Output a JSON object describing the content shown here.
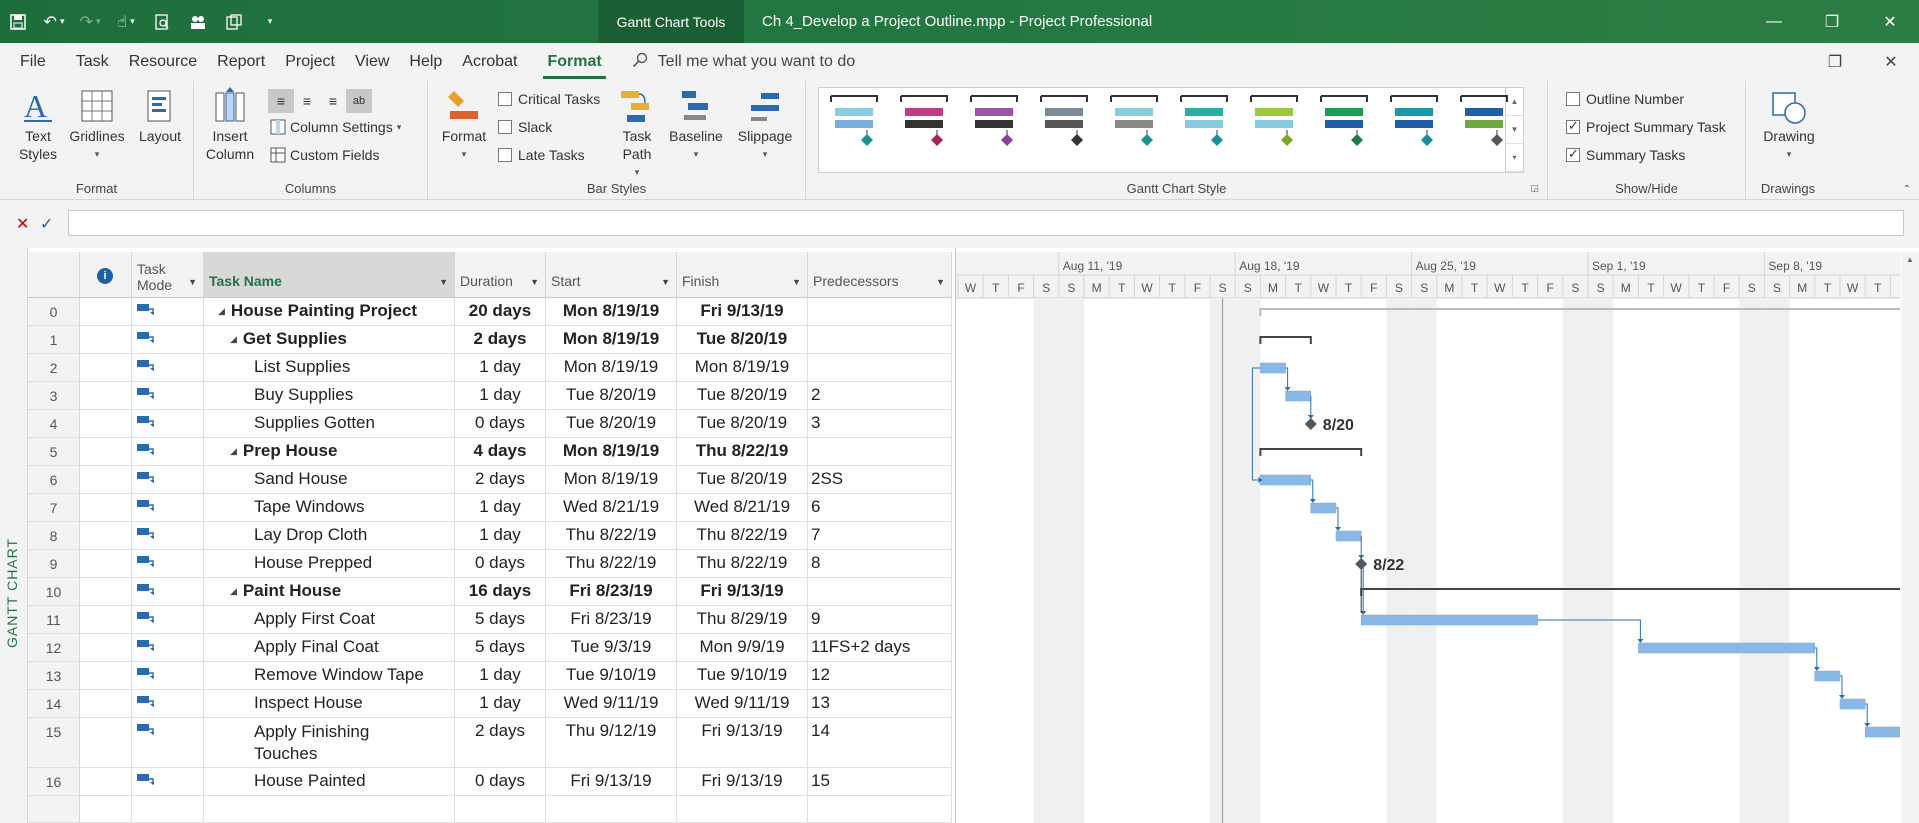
{
  "titlebar": {
    "tools_tab": "Gantt Chart Tools",
    "doc_title": "Ch 4_Develop a Project Outline.mpp  -  Project Professional"
  },
  "menu": {
    "tabs": [
      "File",
      "Task",
      "Resource",
      "Report",
      "Project",
      "View",
      "Help",
      "Acrobat",
      "Format"
    ],
    "active_tab": "Format",
    "tell_me": "Tell me what you want to do"
  },
  "ribbon": {
    "format_group": {
      "label": "Format",
      "text_styles": "Text\nStyles",
      "gridlines": "Gridlines",
      "layout": "Layout"
    },
    "columns_group": {
      "label": "Columns",
      "insert_column": "Insert\nColumn",
      "column_settings": "Column Settings",
      "custom_fields": "Custom Fields"
    },
    "bar_styles_group": {
      "label": "Bar Styles",
      "format": "Format",
      "critical_tasks": "Critical Tasks",
      "slack": "Slack",
      "late_tasks": "Late Tasks",
      "task_path": "Task\nPath",
      "baseline": "Baseline",
      "slippage": "Slippage"
    },
    "gantt_style_group": {
      "label": "Gantt Chart Style",
      "swatches": [
        {
          "top": "#89cce0",
          "bottom": "#7ab0e0",
          "marker": "#1e8f94"
        },
        {
          "top": "#c23c84",
          "bottom": "#333333",
          "marker": "#a0245e"
        },
        {
          "top": "#9b52a8",
          "bottom": "#333333",
          "marker": "#8c3e9b"
        },
        {
          "top": "#7a8a99",
          "bottom": "#555555",
          "marker": "#333333"
        },
        {
          "top": "#89cce0",
          "bottom": "#888888",
          "marker": "#1e8f94"
        },
        {
          "top": "#26b0a0",
          "bottom": "#89cce0",
          "marker": "#1e8f94"
        },
        {
          "top": "#9cc83c",
          "bottom": "#89cce0",
          "marker": "#7aa82a"
        },
        {
          "top": "#1aa050",
          "bottom": "#1f5fa8",
          "marker": "#1a8040"
        },
        {
          "top": "#1a9aa8",
          "bottom": "#1f5fa8",
          "marker": "#1a8a98"
        },
        {
          "top": "#1f5fa8",
          "bottom": "#6fa840",
          "marker": "#555555"
        }
      ]
    },
    "show_hide_group": {
      "label": "Show/Hide",
      "outline_number": {
        "label": "Outline Number",
        "checked": false
      },
      "project_summary_task": {
        "label": "Project Summary Task",
        "checked": true
      },
      "summary_tasks": {
        "label": "Summary Tasks",
        "checked": true
      }
    },
    "drawings_group": {
      "label": "Drawings",
      "drawing": "Drawing"
    }
  },
  "view_label": "GANTT CHART",
  "table": {
    "headers": {
      "mode": "Task\nMode",
      "name": "Task Name",
      "duration": "Duration",
      "start": "Start",
      "finish": "Finish",
      "predecessors": "Predecessors"
    },
    "rows": [
      {
        "id": "0",
        "name": "House Painting Project",
        "level": 0,
        "summary": true,
        "duration": "20 days",
        "start": "Mon 8/19/19",
        "finish": "Fri 9/13/19",
        "pred": ""
      },
      {
        "id": "1",
        "name": "Get Supplies",
        "level": 1,
        "summary": true,
        "duration": "2 days",
        "start": "Mon 8/19/19",
        "finish": "Tue 8/20/19",
        "pred": ""
      },
      {
        "id": "2",
        "name": "List Supplies",
        "level": 2,
        "summary": false,
        "duration": "1 day",
        "start": "Mon 8/19/19",
        "finish": "Mon 8/19/19",
        "pred": ""
      },
      {
        "id": "3",
        "name": "Buy Supplies",
        "level": 2,
        "summary": false,
        "duration": "1 day",
        "start": "Tue 8/20/19",
        "finish": "Tue 8/20/19",
        "pred": "2"
      },
      {
        "id": "4",
        "name": "Supplies Gotten",
        "level": 2,
        "summary": false,
        "duration": "0 days",
        "start": "Tue 8/20/19",
        "finish": "Tue 8/20/19",
        "pred": "3"
      },
      {
        "id": "5",
        "name": "Prep House",
        "level": 1,
        "summary": true,
        "duration": "4 days",
        "start": "Mon 8/19/19",
        "finish": "Thu 8/22/19",
        "pred": ""
      },
      {
        "id": "6",
        "name": "Sand House",
        "level": 2,
        "summary": false,
        "duration": "2 days",
        "start": "Mon 8/19/19",
        "finish": "Tue 8/20/19",
        "pred": "2SS"
      },
      {
        "id": "7",
        "name": "Tape Windows",
        "level": 2,
        "summary": false,
        "duration": "1 day",
        "start": "Wed 8/21/19",
        "finish": "Wed 8/21/19",
        "pred": "6"
      },
      {
        "id": "8",
        "name": "Lay Drop Cloth",
        "level": 2,
        "summary": false,
        "duration": "1 day",
        "start": "Thu 8/22/19",
        "finish": "Thu 8/22/19",
        "pred": "7"
      },
      {
        "id": "9",
        "name": "House Prepped",
        "level": 2,
        "summary": false,
        "duration": "0 days",
        "start": "Thu 8/22/19",
        "finish": "Thu 8/22/19",
        "pred": "8"
      },
      {
        "id": "10",
        "name": "Paint House",
        "level": 1,
        "summary": true,
        "duration": "16 days",
        "start": "Fri 8/23/19",
        "finish": "Fri 9/13/19",
        "pred": ""
      },
      {
        "id": "11",
        "name": "Apply First Coat",
        "level": 2,
        "summary": false,
        "duration": "5 days",
        "start": "Fri 8/23/19",
        "finish": "Thu 8/29/19",
        "pred": "9"
      },
      {
        "id": "12",
        "name": "Apply Final Coat",
        "level": 2,
        "summary": false,
        "duration": "5 days",
        "start": "Tue 9/3/19",
        "finish": "Mon 9/9/19",
        "pred": "11FS+2 days"
      },
      {
        "id": "13",
        "name": "Remove Window Tape",
        "level": 2,
        "summary": false,
        "duration": "1 day",
        "start": "Tue 9/10/19",
        "finish": "Tue 9/10/19",
        "pred": "12"
      },
      {
        "id": "14",
        "name": "Inspect House",
        "level": 2,
        "summary": false,
        "duration": "1 day",
        "start": "Wed 9/11/19",
        "finish": "Wed 9/11/19",
        "pred": "13"
      },
      {
        "id": "15",
        "name": "Apply Finishing Touches",
        "name_line1": "Apply Finishing",
        "name_line2": "Touches",
        "level": 2,
        "summary": false,
        "duration": "2 days",
        "start": "Thu 9/12/19",
        "finish": "Fri 9/13/19",
        "pred": "14"
      },
      {
        "id": "16",
        "name": "House Painted",
        "level": 2,
        "summary": false,
        "duration": "0 days",
        "start": "Fri 9/13/19",
        "finish": "Fri 9/13/19",
        "pred": "15"
      }
    ]
  },
  "gantt": {
    "weeks": [
      "Aug 11, '19",
      "Aug 18, '19",
      "Aug 25, '19",
      "Sep 1, '19",
      "Sep 8, '19"
    ],
    "day_letters": [
      "W",
      "T",
      "F",
      "S",
      "S",
      "M",
      "T",
      "W",
      "T",
      "F",
      "S",
      "S",
      "M",
      "T",
      "W",
      "T",
      "F",
      "S",
      "S",
      "M",
      "T",
      "W",
      "T",
      "F",
      "S",
      "S",
      "M",
      "T",
      "W",
      "T",
      "F",
      "S",
      "S",
      "M",
      "T",
      "W",
      "T",
      "F"
    ],
    "first_day_date": "2019-08-07",
    "today_date": "2019-08-17",
    "milestone_labels": [
      {
        "row": 4,
        "text": "8/20"
      },
      {
        "row": 9,
        "text": "8/22"
      }
    ],
    "bars": [
      {
        "row": 0,
        "start": "2019-08-19",
        "end": "2019-09-13",
        "type": "project"
      },
      {
        "row": 1,
        "start": "2019-08-19",
        "end": "2019-08-20",
        "type": "summary"
      },
      {
        "row": 2,
        "start": "2019-08-19",
        "end": "2019-08-19",
        "type": "task"
      },
      {
        "row": 3,
        "start": "2019-08-20",
        "end": "2019-08-20",
        "type": "task"
      },
      {
        "row": 4,
        "start": "2019-08-20",
        "end": "2019-08-20",
        "type": "milestone"
      },
      {
        "row": 5,
        "start": "2019-08-19",
        "end": "2019-08-22",
        "type": "summary"
      },
      {
        "row": 6,
        "start": "2019-08-19",
        "end": "2019-08-20",
        "type": "task"
      },
      {
        "row": 7,
        "start": "2019-08-21",
        "end": "2019-08-21",
        "type": "task"
      },
      {
        "row": 8,
        "start": "2019-08-22",
        "end": "2019-08-22",
        "type": "task"
      },
      {
        "row": 9,
        "start": "2019-08-22",
        "end": "2019-08-22",
        "type": "milestone"
      },
      {
        "row": 10,
        "start": "2019-08-23",
        "end": "2019-09-13",
        "type": "summary"
      },
      {
        "row": 11,
        "start": "2019-08-23",
        "end": "2019-08-29",
        "type": "task"
      },
      {
        "row": 12,
        "start": "2019-09-03",
        "end": "2019-09-09",
        "type": "task"
      },
      {
        "row": 13,
        "start": "2019-09-10",
        "end": "2019-09-10",
        "type": "task"
      },
      {
        "row": 14,
        "start": "2019-09-11",
        "end": "2019-09-11",
        "type": "task"
      },
      {
        "row": 15,
        "start": "2019-09-12",
        "end": "2019-09-13",
        "type": "task"
      }
    ]
  }
}
